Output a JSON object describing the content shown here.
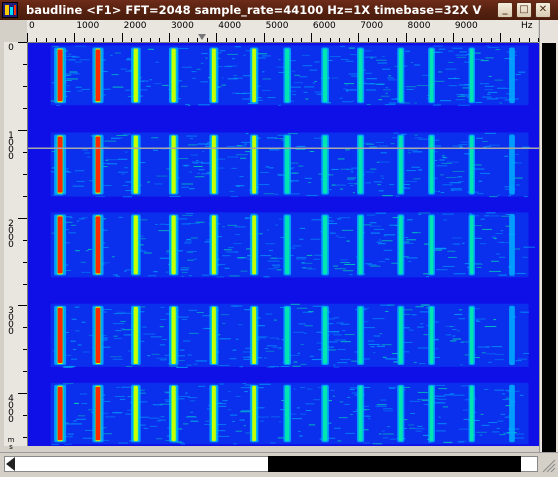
{
  "window": {
    "app_name": "baudline",
    "title": "baudline  <F1> FFT=2048 sample_rate=44100 Hz=1X timebase=32X  V",
    "icons": {
      "app": "baudline-app-icon",
      "minimize": "minimize-icon",
      "maximize": "maximize-icon",
      "close": "close-icon"
    },
    "buttons": {
      "minimize_glyph": "_",
      "maximize_glyph": "□",
      "close_glyph": "✕"
    }
  },
  "frequency_axis": {
    "unit": "Hz",
    "tick_labels": [
      "0",
      "1000",
      "2000",
      "3000",
      "4000",
      "5000",
      "6000",
      "7000",
      "8000",
      "9000"
    ],
    "range": [
      0,
      10800
    ],
    "marker_hz": 4000
  },
  "time_axis": {
    "unit": "ms",
    "tick_labels": [
      "0",
      "1000",
      "2000",
      "3000",
      "4000"
    ],
    "range_ms": [
      0,
      4600
    ]
  },
  "display": {
    "colors": {
      "background": "#0f0fe8",
      "noise": "#00aaff",
      "medium": "#00e6b0",
      "strong": "#c8ff00",
      "peak": "#ff2a00",
      "cursor_line": "#a8a8a8"
    },
    "cursor_time_ms": 1210
  },
  "chart_data": {
    "type": "heatmap",
    "title": "",
    "xlabel": "Hz",
    "ylabel": "ms",
    "xlim": [
      0,
      10800
    ],
    "ylim": [
      0,
      4600
    ],
    "harmonics_hz": [
      700,
      1500,
      2300,
      3100,
      3950,
      4800,
      5500,
      6300,
      7050,
      7900,
      8550,
      9400,
      10250
    ],
    "harmonic_intensity": [
      1.0,
      0.9,
      0.7,
      0.68,
      0.62,
      0.55,
      0.45,
      0.45,
      0.4,
      0.38,
      0.35,
      0.3,
      0.22
    ],
    "bursts_ms": [
      [
        40,
        720
      ],
      [
        1030,
        1760
      ],
      [
        1940,
        2680
      ],
      [
        2980,
        3700
      ],
      [
        3880,
        4580
      ]
    ]
  }
}
